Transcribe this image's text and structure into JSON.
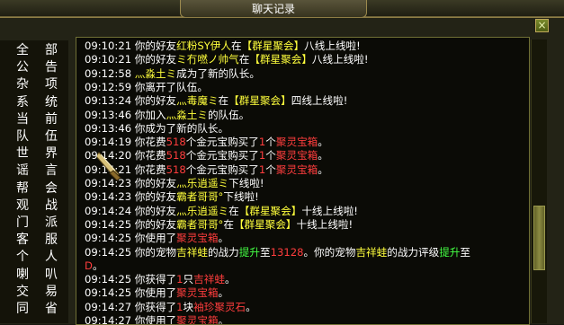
{
  "window": {
    "title": "聊天记录",
    "close_symbol": "×"
  },
  "sidebar": {
    "items": [
      {
        "a": "全",
        "b": "部"
      },
      {
        "a": "公",
        "b": "告"
      },
      {
        "a": "杂",
        "b": "项"
      },
      {
        "a": "系",
        "b": "统"
      },
      {
        "a": "当",
        "b": "前"
      },
      {
        "a": "队",
        "b": "伍"
      },
      {
        "a": "世",
        "b": "界"
      },
      {
        "a": "谣",
        "b": "言"
      },
      {
        "a": "帮",
        "b": "会"
      },
      {
        "a": "观",
        "b": "战"
      },
      {
        "a": "门",
        "b": "派"
      },
      {
        "a": "客",
        "b": "服"
      },
      {
        "a": "个",
        "b": "人"
      },
      {
        "a": "喇",
        "b": "叭"
      },
      {
        "a": "交",
        "b": "易"
      },
      {
        "a": "同",
        "b": "省"
      }
    ],
    "selected_index": 2
  },
  "chat": {
    "lines": [
      {
        "segs": [
          [
            "09:10:21 ",
            "ts"
          ],
          [
            "你的好友",
            "w"
          ],
          [
            "红粉SY伊人",
            "y"
          ],
          [
            "在",
            "w"
          ],
          [
            "【群星聚会】",
            "y"
          ],
          [
            "八线上线啦!",
            "w"
          ]
        ]
      },
      {
        "segs": [
          [
            "09:10:21 ",
            "ts"
          ],
          [
            "你的好友",
            "w"
          ],
          [
            "ミ冇嘫ノ帅气",
            "y"
          ],
          [
            "在",
            "w"
          ],
          [
            "【群星聚会】",
            "y"
          ],
          [
            "八线上线啦!",
            "w"
          ]
        ]
      },
      {
        "segs": [
          [
            "09:12:58 ",
            "ts"
          ],
          [
            "灬淼土ミ",
            "y"
          ],
          [
            "成为了新的队长。",
            "w"
          ]
        ]
      },
      {
        "segs": [
          [
            "09:12:59 ",
            "ts"
          ],
          [
            "你离开了队伍。",
            "w"
          ]
        ]
      },
      {
        "segs": [
          [
            "09:13:24 ",
            "ts"
          ],
          [
            "你的好友",
            "w"
          ],
          [
            "灬毒魔ミ",
            "y"
          ],
          [
            "在",
            "w"
          ],
          [
            "【群星聚会】",
            "y"
          ],
          [
            "四线上线啦!",
            "w"
          ]
        ]
      },
      {
        "segs": [
          [
            "09:13:46 ",
            "ts"
          ],
          [
            "你加入",
            "w"
          ],
          [
            "灬淼土ミ",
            "y"
          ],
          [
            "的队伍。",
            "w"
          ]
        ]
      },
      {
        "segs": [
          [
            "09:13:46 ",
            "ts"
          ],
          [
            "你成为了新的队长。",
            "w"
          ]
        ]
      },
      {
        "segs": [
          [
            "09:14:19 ",
            "ts"
          ],
          [
            "你花费",
            "w"
          ],
          [
            "518",
            "r"
          ],
          [
            "个金元宝购买了",
            "w"
          ],
          [
            "1",
            "r"
          ],
          [
            "个",
            "w"
          ],
          [
            "聚灵宝箱",
            "r"
          ],
          [
            "。",
            "w"
          ]
        ]
      },
      {
        "segs": [
          [
            "09:14:20 ",
            "ts"
          ],
          [
            "你花费",
            "w"
          ],
          [
            "518",
            "r"
          ],
          [
            "个金元宝购买了",
            "w"
          ],
          [
            "1",
            "r"
          ],
          [
            "个",
            "w"
          ],
          [
            "聚灵宝箱",
            "r"
          ],
          [
            "。",
            "w"
          ]
        ]
      },
      {
        "segs": [
          [
            "09:14:21 ",
            "ts"
          ],
          [
            "你花费",
            "w"
          ],
          [
            "518",
            "r"
          ],
          [
            "个金元宝购买了",
            "w"
          ],
          [
            "1",
            "r"
          ],
          [
            "个",
            "w"
          ],
          [
            "聚灵宝箱",
            "r"
          ],
          [
            "。",
            "w"
          ]
        ]
      },
      {
        "segs": [
          [
            "09:14:23 ",
            "ts"
          ],
          [
            "你的好友",
            "w"
          ],
          [
            "灬乐逍遥ミ",
            "y"
          ],
          [
            "下线啦!",
            "w"
          ]
        ]
      },
      {
        "segs": [
          [
            "09:14:23 ",
            "ts"
          ],
          [
            "你的好友",
            "w"
          ],
          [
            "霸者哥哥°",
            "y"
          ],
          [
            "下线啦!",
            "w"
          ]
        ]
      },
      {
        "segs": [
          [
            "09:14:24 ",
            "ts"
          ],
          [
            "你的好友",
            "w"
          ],
          [
            "灬乐逍遥ミ",
            "y"
          ],
          [
            "在",
            "w"
          ],
          [
            "【群星聚会】",
            "y"
          ],
          [
            "十线上线啦!",
            "w"
          ]
        ]
      },
      {
        "segs": [
          [
            "09:14:25 ",
            "ts"
          ],
          [
            "你的好友",
            "w"
          ],
          [
            "霸者哥哥°",
            "y"
          ],
          [
            "在",
            "w"
          ],
          [
            "【群星聚会】",
            "y"
          ],
          [
            "十线上线啦!",
            "w"
          ]
        ]
      },
      {
        "segs": [
          [
            "09:14:25 ",
            "ts"
          ],
          [
            "你使用了",
            "w"
          ],
          [
            "聚灵宝箱",
            "r"
          ],
          [
            "。",
            "w"
          ]
        ]
      },
      {
        "segs": [
          [
            "09:14:25 ",
            "ts"
          ],
          [
            "你的宠物",
            "w"
          ],
          [
            "吉祥蛙",
            "y"
          ],
          [
            "的战力",
            "w"
          ],
          [
            "提升",
            "g"
          ],
          [
            "至",
            "w"
          ],
          [
            "13128",
            "r"
          ],
          [
            "。你的宠物",
            "w"
          ],
          [
            "吉祥蛙",
            "y"
          ],
          [
            "的战力评级",
            "w"
          ],
          [
            "提升",
            "g"
          ],
          [
            "至",
            "w"
          ]
        ]
      },
      {
        "segs": [
          [
            "D",
            "r"
          ],
          [
            "。",
            "w"
          ]
        ]
      },
      {
        "segs": [
          [
            "09:14:25 ",
            "ts"
          ],
          [
            "你获得了",
            "w"
          ],
          [
            "1",
            "r"
          ],
          [
            "只",
            "w"
          ],
          [
            "吉祥蛙",
            "r"
          ],
          [
            "。",
            "w"
          ]
        ]
      },
      {
        "segs": [
          [
            "09:14:25 ",
            "ts"
          ],
          [
            "你使用了",
            "w"
          ],
          [
            "聚灵宝箱",
            "r"
          ],
          [
            "。",
            "w"
          ]
        ]
      },
      {
        "segs": [
          [
            "09:14:27 ",
            "ts"
          ],
          [
            "你获得了",
            "w"
          ],
          [
            "1",
            "r"
          ],
          [
            "块",
            "w"
          ],
          [
            "袖珍聚灵石",
            "r"
          ],
          [
            "。",
            "w"
          ]
        ]
      },
      {
        "segs": [
          [
            "09:14:27 ",
            "ts"
          ],
          [
            "你使用了",
            "w"
          ],
          [
            "聚灵宝箱",
            "r"
          ],
          [
            "。",
            "w"
          ]
        ]
      }
    ]
  },
  "colors": {
    "ts": "#ffffff",
    "w": "#ffffff",
    "y": "#ffff3c",
    "r": "#ff3d3d",
    "g": "#44ff44",
    "frame_border": "#8e7d45",
    "sidebar_bg": "#141309",
    "chat_bg": "#0b0b06"
  },
  "icons": {
    "close": "close-icon",
    "cursor": "sword-cursor-icon"
  }
}
